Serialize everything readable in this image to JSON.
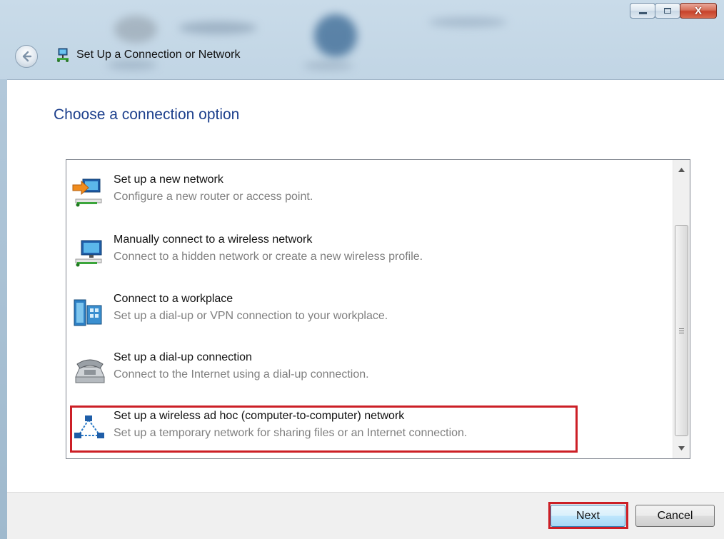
{
  "window": {
    "title": "Set Up a Connection or Network",
    "close_glyph": "X"
  },
  "main": {
    "heading": "Choose a connection option",
    "options": [
      {
        "title": "Set up a new network",
        "desc": "Configure a new router or access point.",
        "icon": "network-setup-icon"
      },
      {
        "title": "Manually connect to a wireless network",
        "desc": "Connect to a hidden network or create a new wireless profile.",
        "icon": "wireless-network-icon"
      },
      {
        "title": "Connect to a workplace",
        "desc": "Set up a dial-up or VPN connection to your workplace.",
        "icon": "workplace-icon"
      },
      {
        "title": "Set up a dial-up connection",
        "desc": "Connect to the Internet using a dial-up connection.",
        "icon": "phone-icon"
      },
      {
        "title": "Set up a wireless ad hoc (computer-to-computer) network",
        "desc": "Set up a temporary network for sharing files or an Internet connection.",
        "icon": "adhoc-network-icon"
      }
    ],
    "highlighted_option": 4
  },
  "footer": {
    "next_label": "Next",
    "cancel_label": "Cancel"
  },
  "colors": {
    "heading": "#1c3f8c",
    "highlight": "#cc1f26",
    "desc": "#7f7f7f"
  }
}
